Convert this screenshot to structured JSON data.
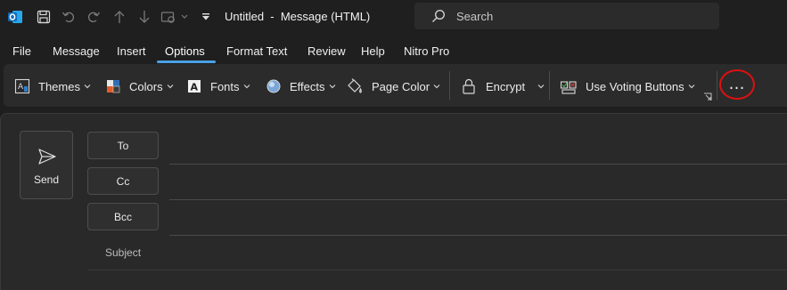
{
  "window": {
    "title": "Untitled  -  Message (HTML)",
    "search_placeholder": "Search"
  },
  "quick_access": [
    {
      "name": "outlook-logo-icon"
    },
    {
      "name": "save-icon"
    },
    {
      "name": "undo-icon"
    },
    {
      "name": "redo-icon"
    },
    {
      "name": "up-arrow-icon"
    },
    {
      "name": "down-arrow-icon"
    },
    {
      "name": "insert-image-icon"
    },
    {
      "name": "customize-qat-icon"
    }
  ],
  "menu": {
    "tabs": [
      "File",
      "Message",
      "Insert",
      "Options",
      "Format Text",
      "Review",
      "Help",
      "Nitro Pro"
    ],
    "active": "Options"
  },
  "ribbon": {
    "themes": "Themes",
    "colors": "Colors",
    "fonts": "Fonts",
    "effects": "Effects",
    "page_color": "Page Color",
    "encrypt": "Encrypt",
    "voting": "Use Voting Buttons",
    "more": "…"
  },
  "compose": {
    "send": "Send",
    "to": "To",
    "cc": "Cc",
    "bcc": "Bcc",
    "subject": "Subject"
  },
  "colors": {
    "accent": "#4aa0e6",
    "highlight_circle": "#e01010",
    "outlook_blue": "#0f6cbd"
  }
}
